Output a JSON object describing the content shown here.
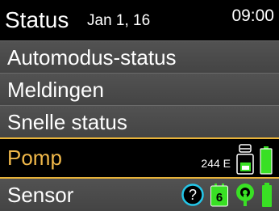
{
  "header": {
    "title": "Status",
    "date": "Jan 1, 16",
    "time": "09:00"
  },
  "menu": {
    "items": [
      {
        "label": "Automodus-status"
      },
      {
        "label": "Meldingen"
      },
      {
        "label": "Snelle status"
      },
      {
        "label": "Pomp"
      },
      {
        "label": "Sensor"
      }
    ]
  },
  "pump": {
    "reservoir_units": "244 E"
  },
  "sensor": {
    "help_symbol": "?",
    "calendar_value": "6"
  },
  "icons": {
    "reservoir": "reservoir-icon",
    "battery": "battery-icon",
    "help": "help-icon",
    "calendar": "calendar-icon",
    "sensor_signal": "sensor-signal-icon"
  },
  "colors": {
    "accent": "#f0b84a",
    "highlight_border": "#e8b33a",
    "battery_green": "#39e024",
    "help_cyan": "#24c6e8",
    "item_gray": "#4b4b4b"
  }
}
